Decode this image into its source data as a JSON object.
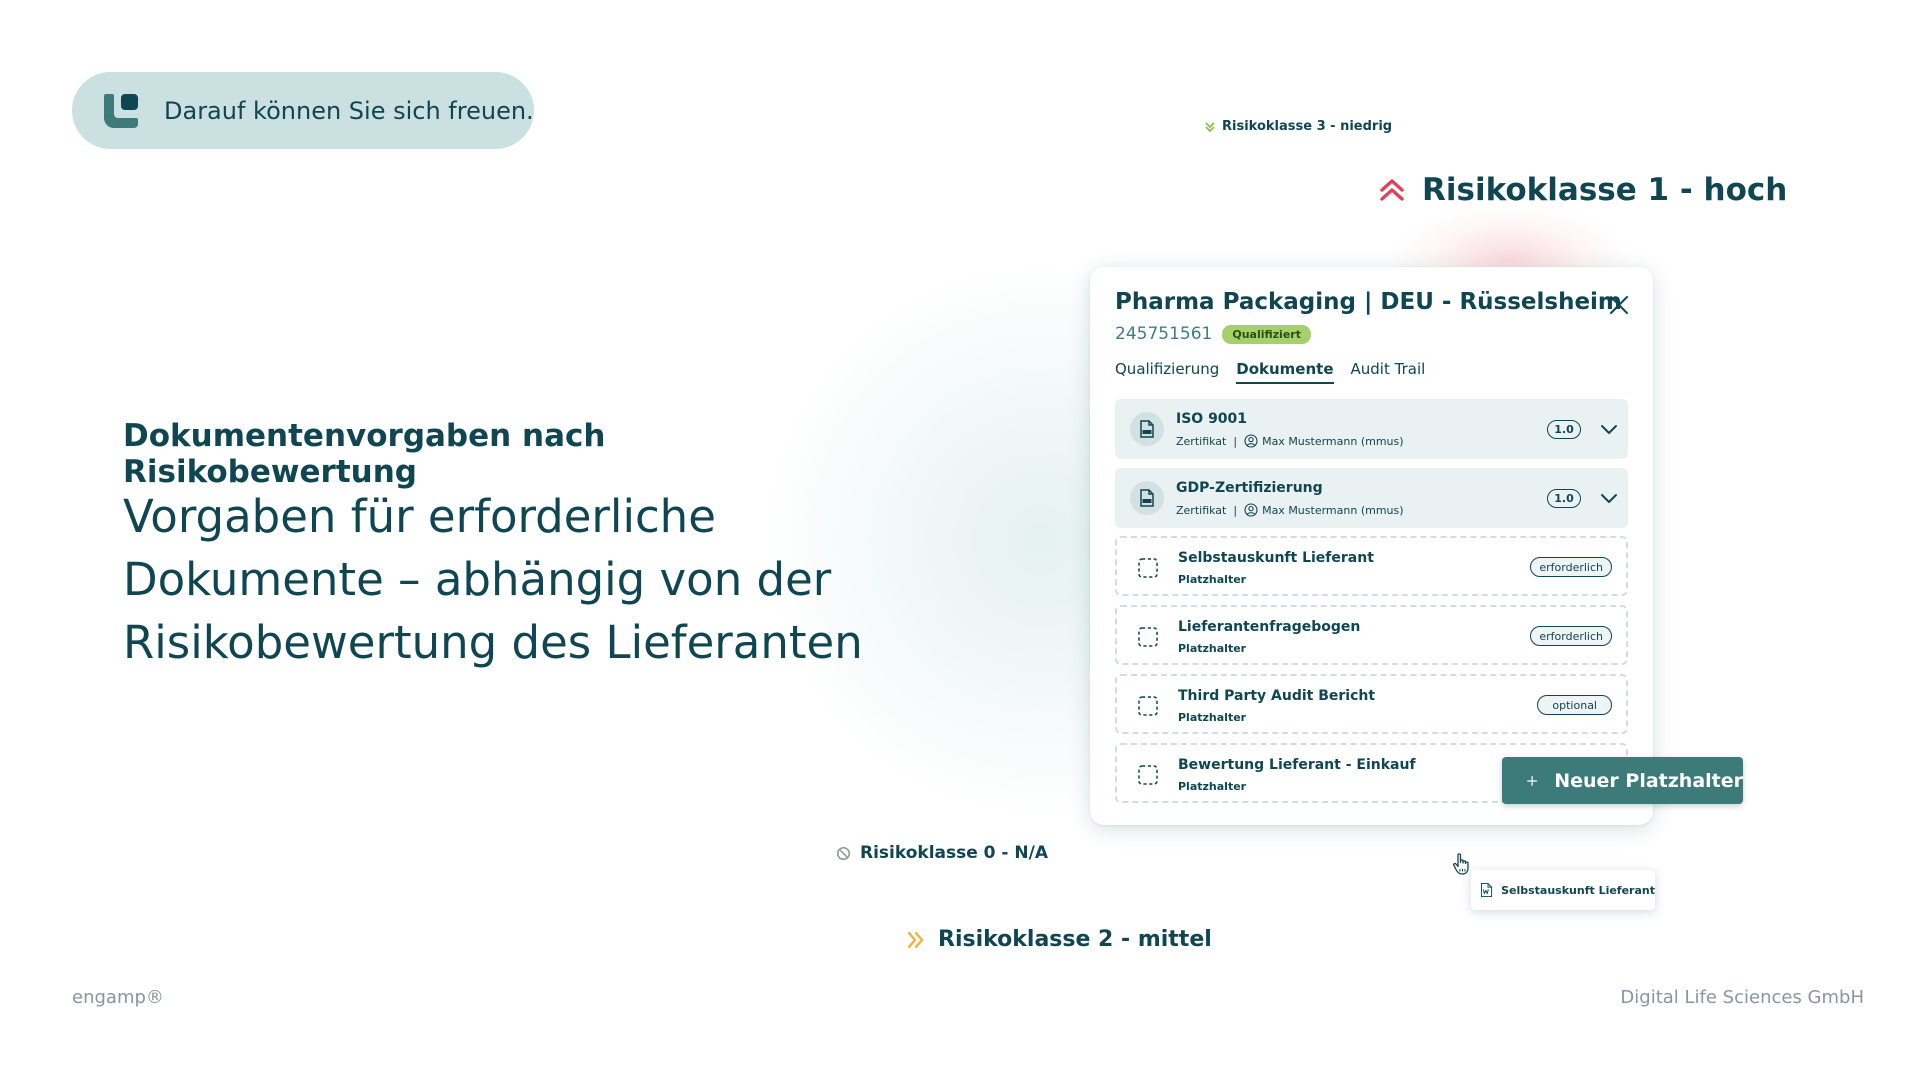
{
  "pill": {
    "text": "Darauf können Sie sich freuen.",
    "icon": "engamp-logo-icon"
  },
  "heading": "Dokumentenvorgaben nach Risikobewertung",
  "lead_lines": [
    "Vorgaben für erforderliche",
    "Dokumente – abhängig von der",
    "Risikobewertung des Lieferanten"
  ],
  "risk_labels": {
    "r3": {
      "text": "Risikoklasse 3 - niedrig",
      "icon": "chevron-down-icon",
      "color": "#8bc34a"
    },
    "r1": {
      "text": "Risikoklasse 1 - hoch",
      "icon": "double-chevron-up-icon",
      "color": "#e4405a"
    },
    "r0": {
      "text": "Risikoklasse 0 - N/A",
      "icon": "block-icon",
      "color": "#8a9699"
    },
    "r2": {
      "text": "Risikoklasse 2 - mittel",
      "icon": "double-chevron-right-icon",
      "color": "#f2b33d"
    }
  },
  "card": {
    "title": "Pharma Packaging | DEU - Rüsselsheim",
    "supplier_id": "245751561",
    "status_badge": "Qualifiziert",
    "tabs": [
      {
        "label": "Qualifizierung",
        "active": false
      },
      {
        "label": "Dokumente",
        "active": true
      },
      {
        "label": "Audit Trail",
        "active": false
      }
    ],
    "documents": [
      {
        "title": "ISO 9001",
        "type": "Zertifikat",
        "owner": "Max Mustermann (mmus)",
        "version": "1.0"
      },
      {
        "title": "GDP-Zertifizierung",
        "type": "Zertifikat",
        "owner": "Max Mustermann (mmus)",
        "version": "1.0"
      }
    ],
    "placeholders": [
      {
        "title": "Selbstauskunft Lieferant",
        "sub": "Platzhalter",
        "tag": "erforderlich"
      },
      {
        "title": "Lieferantenfragebogen",
        "sub": "Platzhalter",
        "tag": "erforderlich"
      },
      {
        "title": "Third Party Audit Bericht",
        "sub": "Platzhalter",
        "tag": "optional"
      },
      {
        "title": "Bewertung Lieferant - Einkauf",
        "sub": "Platzhalter",
        "tag": ""
      }
    ]
  },
  "new_button": "Neuer Platzhalter",
  "drag_chip": "Selbstauskunft Lieferant",
  "footer": {
    "left": "engamp®",
    "right": "Digital Life Sciences GmbH"
  },
  "colors": {
    "primary": "#0f4652",
    "accent": "#3c7b7a",
    "pill_bg": "#cbe0e0",
    "badge": "#a5d06b"
  }
}
